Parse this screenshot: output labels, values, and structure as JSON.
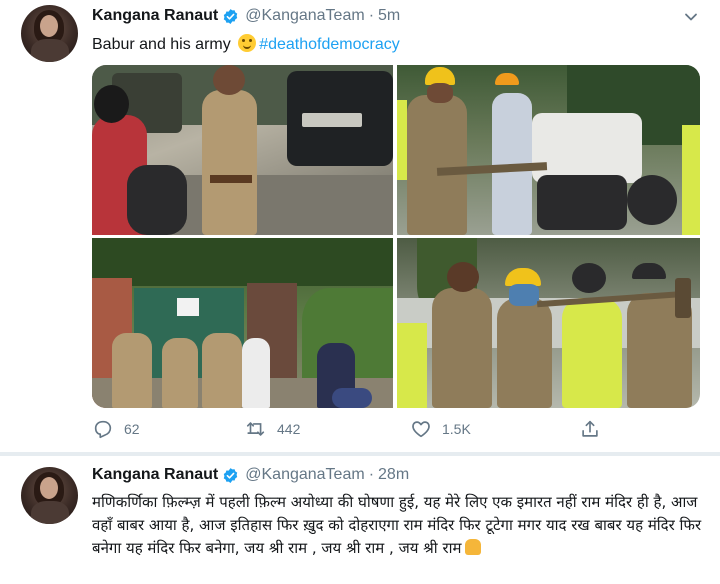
{
  "tweets": [
    {
      "author": "Kangana Ranaut",
      "handle": "@KanganaTeam",
      "separator": "·",
      "time": "5m",
      "text_main": "Babur and his army",
      "hashtag": "#deathofdemocracy",
      "icons": [
        "avatar",
        "verified-badge-icon",
        "chevron-down-icon",
        "smile-emoji-icon"
      ],
      "stats": {
        "replies": "62",
        "retweets": "442",
        "likes": "1.5K"
      }
    },
    {
      "author": "Kangana Ranaut",
      "handle": "@KanganaTeam",
      "separator": "·",
      "time": "28m",
      "text": "मणिकर्णिका फ़िल्म्ज़ में पहली फ़िल्म अयोध्या की घोषणा हुई, यह मेरे लिए एक इमारत नहीं राम मंदिर ही है, आज वहाँ बाबर आया है, आज इतिहास फिर ख़ुद को दोहराएगा राम मंदिर फिर टूटेगा मगर याद रख बाबर यह मंदिर फिर बनेगा यह मंदिर फिर बनेगा, जय श्री राम , जय श्री राम , जय श्री राम",
      "icons": [
        "avatar",
        "verified-badge-icon",
        "praying-hands-emoji-icon"
      ]
    }
  ],
  "colors": {
    "accent": "#1da1f2",
    "muted": "#657786",
    "text": "#14171a",
    "divider": "#e6ecf0"
  }
}
